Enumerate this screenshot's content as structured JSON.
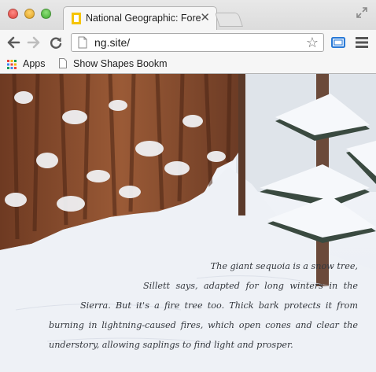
{
  "browser": {
    "tab": {
      "title": "National Geographic: Forest",
      "close_glyph": "✕"
    },
    "new_tab": {
      "icon": "new-tab-icon"
    },
    "toolbar": {
      "url": "ng.site/",
      "star_glyph": "☆"
    },
    "bookmarks": {
      "apps_label": "Apps",
      "items": [
        {
          "label": "Show Shapes Bookmarklet"
        }
      ]
    },
    "colors": {
      "close": "#e0443e",
      "minimize": "#dea123",
      "maximize": "#3faa2f",
      "favicon": "#f5c400",
      "cast_blue": "#2a7ad6"
    }
  },
  "article": {
    "caption_lines": [
      "The giant sequoia is a snow tree,",
      "Sillett says, adapted for long winters in the",
      "Sierra. But it's a fire tree too. Thick bark protects it from",
      "burning in lightning-caused fires, which open cones and clear the",
      "understory, allowing saplings to find light and prosper."
    ]
  }
}
